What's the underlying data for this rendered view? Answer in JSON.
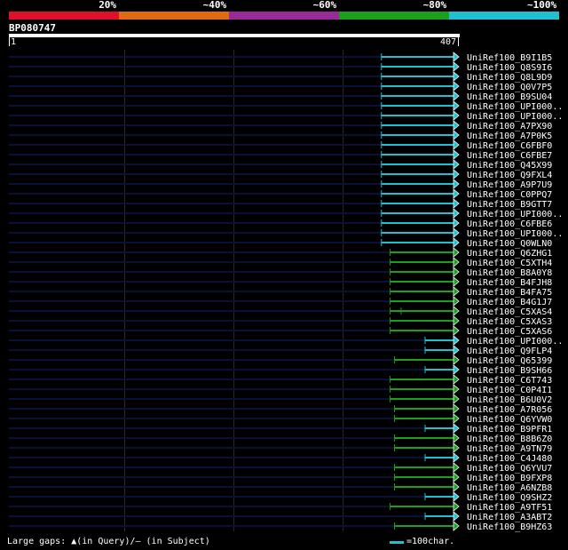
{
  "legend": {
    "segments": [
      {
        "label": "20%",
        "color": "#e0102a"
      },
      {
        "label": "~40%",
        "color": "#e06a10"
      },
      {
        "label": "~60%",
        "color": "#9a2a9a"
      },
      {
        "label": "~80%",
        "color": "#1aa01a"
      },
      {
        "label": "~100%",
        "color": "#1fc0d0"
      }
    ]
  },
  "query": {
    "name": "BP080747",
    "start": "1",
    "end": "407"
  },
  "colors": {
    "cyan": "#1fc0d0",
    "green": "#1aa01a",
    "track": "#0b1038",
    "grid": "#2a2a2a"
  },
  "hits": [
    {
      "label": "UniRef100_B9I1B5",
      "color": "cyan",
      "start": 341
    },
    {
      "label": "UniRef100_Q8S9I6",
      "color": "cyan",
      "start": 341
    },
    {
      "label": "UniRef100_Q8L9D9",
      "color": "cyan",
      "start": 341
    },
    {
      "label": "UniRef100_Q0V7P5",
      "color": "cyan",
      "start": 341
    },
    {
      "label": "UniRef100_B9SU04",
      "color": "cyan",
      "start": 341
    },
    {
      "label": "UniRef100_UPI000..",
      "color": "cyan",
      "start": 341
    },
    {
      "label": "UniRef100_UPI000..",
      "color": "cyan",
      "start": 341
    },
    {
      "label": "UniRef100_A7PX90",
      "color": "cyan",
      "start": 341
    },
    {
      "label": "UniRef100_A7P0K5",
      "color": "cyan",
      "start": 341
    },
    {
      "label": "UniRef100_C6FBF0",
      "color": "cyan",
      "start": 341
    },
    {
      "label": "UniRef100_C6FBE7",
      "color": "cyan",
      "start": 341
    },
    {
      "label": "UniRef100_Q45X99",
      "color": "cyan",
      "start": 341
    },
    {
      "label": "UniRef100_Q9FXL4",
      "color": "cyan",
      "start": 341
    },
    {
      "label": "UniRef100_A9P7U9",
      "color": "cyan",
      "start": 341
    },
    {
      "label": "UniRef100_C0PPQ7",
      "color": "cyan",
      "start": 341
    },
    {
      "label": "UniRef100_B9GTT7",
      "color": "cyan",
      "start": 341
    },
    {
      "label": "UniRef100_UPI000..",
      "color": "cyan",
      "start": 341
    },
    {
      "label": "UniRef100_C6FBE6",
      "color": "cyan",
      "start": 341
    },
    {
      "label": "UniRef100_UPI000..",
      "color": "cyan",
      "start": 341
    },
    {
      "label": "UniRef100_Q0WLN0",
      "color": "cyan",
      "start": 341
    },
    {
      "label": "UniRef100_Q6ZHG1",
      "color": "green",
      "start": 349
    },
    {
      "label": "UniRef100_C5XTH4",
      "color": "green",
      "start": 349
    },
    {
      "label": "UniRef100_B8A0Y8",
      "color": "green",
      "start": 349
    },
    {
      "label": "UniRef100_B4FJH8",
      "color": "green",
      "start": 349
    },
    {
      "label": "UniRef100_B4FA75",
      "color": "green",
      "start": 349
    },
    {
      "label": "UniRef100_B4G1J7",
      "color": "green",
      "start": 349
    },
    {
      "label": "UniRef100_C5XAS4",
      "color": "green",
      "start": 349,
      "gap": 359
    },
    {
      "label": "UniRef100_C5XAS3",
      "color": "green",
      "start": 349
    },
    {
      "label": "UniRef100_C5XAS6",
      "color": "green",
      "start": 349
    },
    {
      "label": "UniRef100_UPI000..",
      "color": "cyan",
      "start": 381
    },
    {
      "label": "UniRef100_Q9FLP4",
      "color": "cyan",
      "start": 381
    },
    {
      "label": "UniRef100_Q65399",
      "color": "green",
      "start": 353
    },
    {
      "label": "UniRef100_B9SH66",
      "color": "cyan",
      "start": 381
    },
    {
      "label": "UniRef100_C6T743",
      "color": "green",
      "start": 349
    },
    {
      "label": "UniRef100_C0P4I1",
      "color": "green",
      "start": 349
    },
    {
      "label": "UniRef100_B6U0V2",
      "color": "green",
      "start": 349
    },
    {
      "label": "UniRef100_A7R056",
      "color": "green",
      "start": 353
    },
    {
      "label": "UniRef100_Q6YVW0",
      "color": "green",
      "start": 353
    },
    {
      "label": "UniRef100_B9PFR1",
      "color": "cyan",
      "start": 381
    },
    {
      "label": "UniRef100_B8B6Z0",
      "color": "green",
      "start": 353
    },
    {
      "label": "UniRef100_A9TN79",
      "color": "green",
      "start": 353
    },
    {
      "label": "UniRef100_C4J480",
      "color": "cyan",
      "start": 381
    },
    {
      "label": "UniRef100_Q6YVU7",
      "color": "green",
      "start": 353
    },
    {
      "label": "UniRef100_B9FXP8",
      "color": "green",
      "start": 353
    },
    {
      "label": "UniRef100_A6NZB8",
      "color": "green",
      "start": 353
    },
    {
      "label": "UniRef100_Q9SHZ2",
      "color": "cyan",
      "start": 381
    },
    {
      "label": "UniRef100_A9TF51",
      "color": "green",
      "start": 349
    },
    {
      "label": "UniRef100_A3ABT2",
      "color": "cyan",
      "start": 381
    },
    {
      "label": "UniRef100_B9HZ63",
      "color": "green",
      "start": 353
    }
  ],
  "footer": {
    "gaps_text": "Large gaps: ▲(in Query)/– (in Subject)",
    "scale_text": "=100char."
  }
}
